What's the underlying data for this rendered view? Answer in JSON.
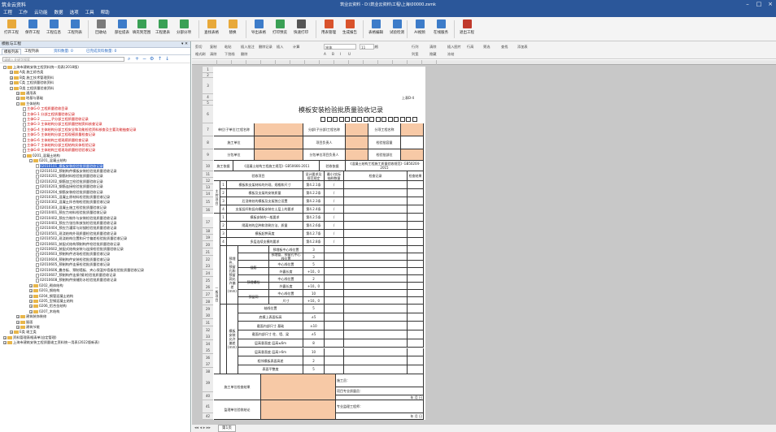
{
  "app": {
    "title": "筑业云资料",
    "document": "筑业云资料 - D:\\筑业云资料\\工程\\上海\\00000.zsmk"
  },
  "menu": [
    "工程",
    "工作",
    "云功能",
    "数据",
    "选项",
    "工具",
    "帮助"
  ],
  "toolbar": [
    {
      "label": "打开工程",
      "color": "#e8a93a"
    },
    {
      "label": "保存工程",
      "color": "#3d7cc9"
    },
    {
      "label": "工程信息",
      "color": "#3d7cc9"
    },
    {
      "label": "工程列表",
      "color": "#3d7cc9"
    },
    {
      "label": "回收站",
      "color": "#7a7a7a"
    },
    {
      "label": "部位提表",
      "color": "#3d7cc9"
    },
    {
      "label": "填充到范围",
      "color": "#3aa055"
    },
    {
      "label": "工程建表",
      "color": "#3aa055"
    },
    {
      "label": "分部分项",
      "color": "#3aa055"
    },
    {
      "label": "查找表格",
      "color": "#e8a93a"
    },
    {
      "label": "替换",
      "color": "#e8a93a"
    },
    {
      "label": "导出表格",
      "color": "#3d7cc9"
    },
    {
      "label": "打印预览",
      "color": "#3aa055"
    },
    {
      "label": "快速打印",
      "color": "#555555"
    },
    {
      "label": "用表管理",
      "color": "#d9532c"
    },
    {
      "label": "生成报告",
      "color": "#d9532c"
    },
    {
      "label": "表格编辑",
      "color": "#3d7cc9"
    },
    {
      "label": "试验检测",
      "color": "#3d7cc9"
    },
    {
      "label": "AI视频",
      "color": "#3d7cc9"
    },
    {
      "label": "在线服务",
      "color": "#3d7cc9"
    },
    {
      "label": "退出工程",
      "color": "#c0392b"
    }
  ],
  "left_panel": {
    "title": "模板与工程",
    "tabs": [
      "模板列表",
      "工程列表",
      "资料数量: 0",
      "已完成资料数量: 0"
    ],
    "search_placeholder": "请输入关键字搜索"
  },
  "tree": [
    {
      "d": 0,
      "t": "上海市建筑安装工程资料统一用表(2018版)",
      "k": "f",
      "e": "-"
    },
    {
      "d": 1,
      "t": "A类 施工综合类",
      "k": "f",
      "e": "+"
    },
    {
      "d": 1,
      "t": "B类 施工技术管理资料",
      "k": "f",
      "e": "+"
    },
    {
      "d": 1,
      "t": "C类 工程质量验收资料",
      "k": "f",
      "e": "+"
    },
    {
      "d": 1,
      "t": "D类 工程质量验收资料",
      "k": "f",
      "e": "-"
    },
    {
      "d": 2,
      "t": "通用表",
      "k": "f",
      "e": "+"
    },
    {
      "d": 2,
      "t": "地基与基础",
      "k": "f",
      "e": "+"
    },
    {
      "d": 2,
      "t": "主体结构",
      "k": "f",
      "e": "-"
    },
    {
      "d": 3,
      "t": "主体G-0 工程质量验收目录",
      "k": "d",
      "r": 1
    },
    {
      "d": 3,
      "t": "主体G-1 分部工程质量验收记录",
      "k": "d",
      "r": 1
    },
    {
      "d": 3,
      "t": "主体G-2 ______子分部工程质量验收记录",
      "k": "d",
      "r": 1
    },
    {
      "d": 3,
      "t": "主体G-3 主体结构分部工程质量控制资料核查记录",
      "k": "d",
      "r": 1
    },
    {
      "d": 3,
      "t": "主体G-4 主体结构分部工程安全和功能检验资料核查及主要功能抽查记录",
      "k": "d",
      "r": 1
    },
    {
      "d": 3,
      "t": "主体G-5 主体结构分部工程观感质量检查记录",
      "k": "d",
      "r": 1
    },
    {
      "d": 3,
      "t": "主体G-6 主体结构工程观感质量检查记录",
      "k": "d",
      "r": 1
    },
    {
      "d": 3,
      "t": "主体G-7 主体结构分部工程结构实体检验记录",
      "k": "d",
      "r": 1
    },
    {
      "d": 3,
      "t": "主体G-8 主体结构工程现场质量检验验收记录",
      "k": "d",
      "r": 1
    },
    {
      "d": 3,
      "t": "0201_混凝土结构",
      "k": "f",
      "e": "-"
    },
    {
      "d": 4,
      "t": "0201_混凝土结构",
      "k": "f",
      "e": "-"
    },
    {
      "d": 5,
      "t": "02010101_模板安装检验批质量验收记录",
      "k": "d",
      "s": 1
    },
    {
      "d": 5,
      "t": "02010102_预制构件模板安装检验批质量验收记录",
      "k": "d"
    },
    {
      "d": 5,
      "t": "02010201_钢筋材料检验批质量验收记录",
      "k": "d"
    },
    {
      "d": 5,
      "t": "02010202_钢筋加工检验批质量验收记录",
      "k": "d"
    },
    {
      "d": 5,
      "t": "02010203_钢筋连接检验批质量验收记录",
      "k": "d"
    },
    {
      "d": 5,
      "t": "02010204_钢筋安装检验批质量验收记录",
      "k": "d"
    },
    {
      "d": 5,
      "t": "02010301_混凝土原材料检验批质量验收记录",
      "k": "d"
    },
    {
      "d": 5,
      "t": "02010302_混凝土拌合物检验批质量验收记录",
      "k": "d"
    },
    {
      "d": 5,
      "t": "02010303_混凝土施工检验批质量验收记录",
      "k": "d"
    },
    {
      "d": 5,
      "t": "02010401_预应力材料检验批质量验收记录",
      "k": "d"
    },
    {
      "d": 5,
      "t": "02010402_预应力制作与安装检验批质量验收记录",
      "k": "d"
    },
    {
      "d": 5,
      "t": "02010403_预应力张拉和放张检验批质量验收记录",
      "k": "d"
    },
    {
      "d": 5,
      "t": "02010404_预应力灌浆与封锚检验批质量验收记录",
      "k": "d"
    },
    {
      "d": 5,
      "t": "02010501_现浇结构外观质量检验批质量验收记录",
      "k": "d"
    },
    {
      "d": 5,
      "t": "02010502_现浇结构位置和尺寸偏差检验批质量验收记录",
      "k": "d"
    },
    {
      "d": 5,
      "t": "02010601_装配式结构预制构件检验批质量验收记录",
      "k": "d"
    },
    {
      "d": 5,
      "t": "02010602_装配式结构安装与连接检验批质量验收记录",
      "k": "d"
    },
    {
      "d": 5,
      "t": "02010603_预制构件进场检验批质量验收记录",
      "k": "d"
    },
    {
      "d": 5,
      "t": "02010604_预制构件安装检验批质量验收记录",
      "k": "d"
    },
    {
      "d": 5,
      "t": "02010605_预制构件连接检验批质量验收记录",
      "k": "d"
    },
    {
      "d": 5,
      "t": "02010606_叠合板、预制墙板、夹心保温外墙板检验批质量验收记录",
      "k": "d"
    },
    {
      "d": 5,
      "t": "02010607_预制构件连接(钢)检验批质量验收记录",
      "k": "d"
    },
    {
      "d": 5,
      "t": "02010608_预制构件接缝防水检验批质量验收记录",
      "k": "d"
    },
    {
      "d": 4,
      "t": "0202_砌体结构",
      "k": "f",
      "e": "+"
    },
    {
      "d": 4,
      "t": "0203_钢结构",
      "k": "f",
      "e": "+"
    },
    {
      "d": 4,
      "t": "0204_钢管混凝土结构",
      "k": "f",
      "e": "+"
    },
    {
      "d": 4,
      "t": "0205_型钢混凝土结构",
      "k": "f",
      "e": "+"
    },
    {
      "d": 4,
      "t": "0206_铝合金结构",
      "k": "f",
      "e": "+"
    },
    {
      "d": 4,
      "t": "0207_木结构",
      "k": "f",
      "e": "+"
    },
    {
      "d": 2,
      "t": "建筑装饰装修",
      "k": "f",
      "e": "+"
    },
    {
      "d": 2,
      "t": "屋面",
      "k": "f",
      "e": "+"
    },
    {
      "d": 2,
      "t": "建筑节能",
      "k": "f",
      "e": "+"
    },
    {
      "d": 1,
      "t": "E类 竣工类",
      "k": "f",
      "e": "+"
    },
    {
      "d": 0,
      "t": "资料管理表格清单(自定管理)",
      "k": "f",
      "e": "+"
    },
    {
      "d": 0,
      "t": "上海市建筑安装工程质量竣工资料统一用表(2022版新表)",
      "k": "f",
      "e": "+"
    }
  ],
  "edit_toolbar": {
    "row1": [
      "剪切",
      "复制",
      "粘贴",
      "插入批注",
      "删除记录",
      "插入",
      "计算",
      "字号",
      "合并单元格",
      "行列",
      "清除",
      "插入图片",
      "行高",
      "筛选",
      "查找",
      "添加表"
    ],
    "row2": [
      "格式刷",
      "清除",
      "下划线",
      "删除",
      "A",
      "B",
      "I",
      "U",
      "列宽",
      "隐藏",
      "冻结"
    ],
    "font": "宋体",
    "size": "11"
  },
  "form": {
    "code": "上表D-4",
    "title": "模板安装检验批质量验收记录",
    "r6": {
      "a": "单位(子单位)工程名称",
      "b": "分部(子分部)工程名称",
      "c": "分项工程名称"
    },
    "r7": {
      "a": "施工单位",
      "b": "项目负责人",
      "c": "检验批容量"
    },
    "r8": {
      "a": "分包单位",
      "b": "分包单位项目负责人",
      "c": "检验批部位"
    },
    "r9": {
      "a": "施工依据",
      "b": "《混凝土结构工程施工规范》GB50666-2011",
      "c": "验收依据",
      "d": "《混凝土结构工程施工质量验收规范》GB50204-2015"
    },
    "r10": [
      "验收项目",
      "设计要求及规范规定",
      "最小/实际抽样数量",
      "检查记录",
      "检查结果"
    ],
    "main_label": "主控项目",
    "general_label": "一般项目",
    "main_items": [
      {
        "n": "1",
        "t": "模板和支架材料的外观、规格和尺寸",
        "s": "第4.2.1条",
        "m": "/"
      },
      {
        "n": "2",
        "t": "模板及支架的安装质量",
        "s": "第4.2.2条",
        "m": "/"
      },
      {
        "n": "3",
        "t": "后浇带处的模板及支架独立设置",
        "s": "第4.2.3条",
        "m": "/"
      },
      {
        "n": "4",
        "t": "支架竖杆和竖向模板安装在土层上的要求",
        "s": "第4.2.4条",
        "m": "/"
      }
    ],
    "gen_items": [
      {
        "n": "1",
        "t": "模板安装的一般要求",
        "s": "第4.2.5条",
        "m": "/"
      },
      {
        "n": "2",
        "t": "隔离剂的品种和涂刷方法、质量",
        "s": "第4.2.6条",
        "m": "/"
      },
      {
        "n": "3",
        "t": "模板起拱高度",
        "s": "第4.2.7条",
        "m": "/"
      },
      {
        "n": "4",
        "t": "多层连续支模的要求",
        "s": "第4.2.8条",
        "m": "/"
      }
    ],
    "dev5_label": "预埋件、预留孔和预留洞允许偏差(mm)",
    "dev5": [
      {
        "g": "",
        "t": "预埋板中心线位置",
        "v": "3"
      },
      {
        "g": "",
        "t": "预埋管、预留孔中心线位置",
        "v": "3"
      },
      {
        "g": "插筋",
        "t": "中心线位置",
        "v": "5"
      },
      {
        "g": "插筋",
        "t": "外露长度",
        "v": "+10，0"
      },
      {
        "g": "预埋螺栓",
        "t": "中心线位置",
        "v": "2"
      },
      {
        "g": "预埋螺栓",
        "t": "外露长度",
        "v": "+10，0"
      },
      {
        "g": "预留洞",
        "t": "中心线位置",
        "v": "10"
      },
      {
        "g": "预留洞",
        "t": "尺寸",
        "v": "+10，0"
      }
    ],
    "dev6_label": "模板安装允许偏差(mm)",
    "dev6": [
      {
        "t": "轴线位置",
        "v": "5"
      },
      {
        "t": "底模上表面标高",
        "v": "±5"
      },
      {
        "t": "截面内部尺寸 基础",
        "v": "±10"
      },
      {
        "t": "截面内部尺寸 柱、墙、梁",
        "v": "±5"
      },
      {
        "t": "层高垂直度 层高≤6m",
        "v": "8"
      },
      {
        "t": "层高垂直度 层高>6m",
        "v": "10"
      },
      {
        "t": "相邻模板表面高差",
        "v": "2"
      },
      {
        "t": "表面平整度",
        "v": "5"
      }
    ],
    "sign1": {
      "label": "施工单位检查结果",
      "a": "施工员：",
      "b": "项目专业质量员：",
      "date": "年  月  日"
    },
    "sign2": {
      "label": "监理单位验收结论",
      "a": "专业监理工程师：",
      "date": "年  月  日"
    }
  },
  "status": {
    "sheet": "第1页"
  }
}
